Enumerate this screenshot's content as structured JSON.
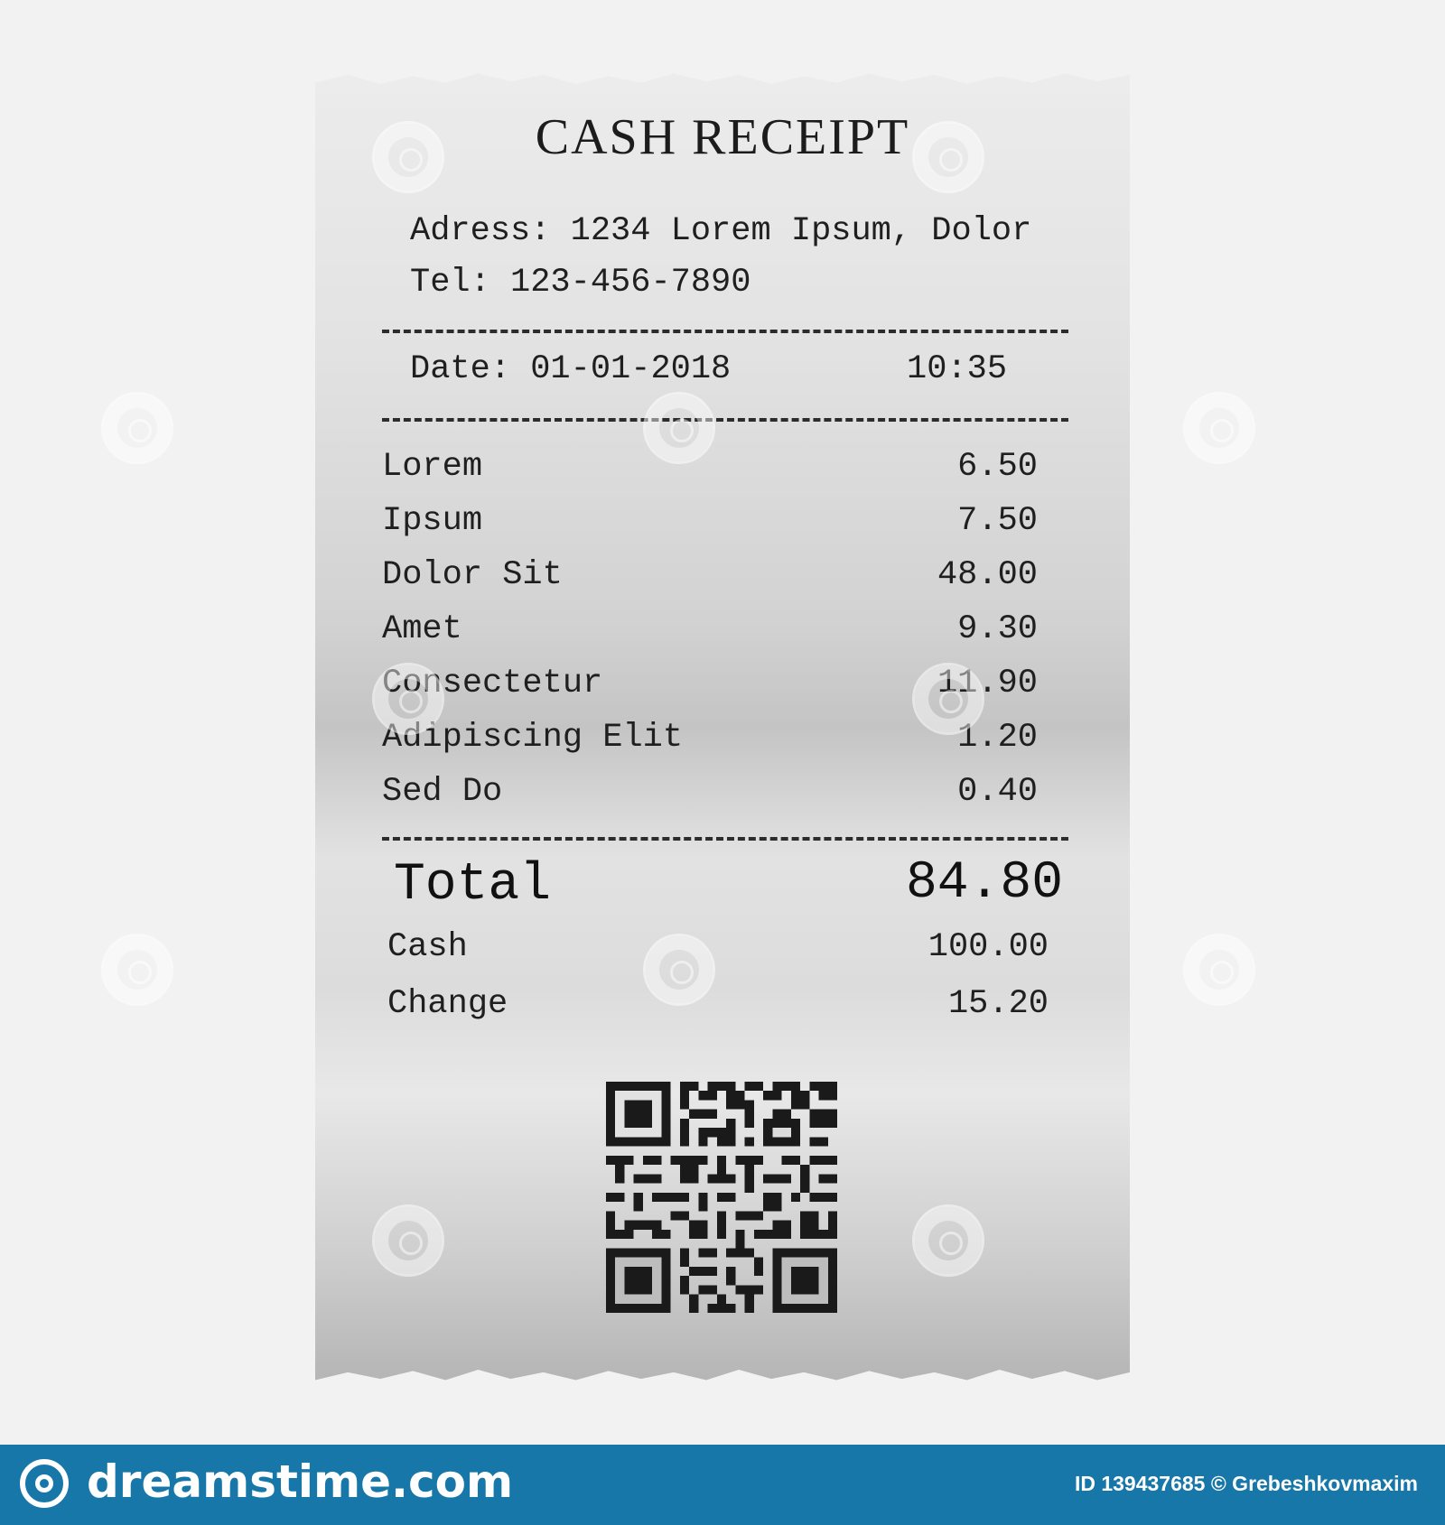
{
  "receipt": {
    "title": "CASH RECEIPT",
    "address": "Adress: 1234 Lorem Ipsum, Dolor",
    "tel": "Tel: 123-456-7890",
    "date": "Date: 01-01-2018",
    "time": "10:35",
    "items": [
      {
        "name": "Lorem",
        "price": "6.50"
      },
      {
        "name": "Ipsum",
        "price": "7.50"
      },
      {
        "name": "Dolor Sit",
        "price": "48.00"
      },
      {
        "name": "Amet",
        "price": "9.30"
      },
      {
        "name": "Consectetur",
        "price": "11.90"
      },
      {
        "name": "Adipiscing Elit",
        "price": "1.20"
      },
      {
        "name": "Sed Do",
        "price": "0.40"
      }
    ],
    "total_label": "Total",
    "total_value": "84.80",
    "cash_label": "Cash",
    "cash_value": "100.00",
    "change_label": "Change",
    "change_value": "15.20",
    "qr_icon": "qr-code-icon"
  },
  "footer": {
    "logo_text": "dreamstime.com",
    "credit": "ID 139437685 © Grebeshkovmaxim",
    "background": "#1677a8",
    "logo_icon": "dreamstime-spiral-icon"
  }
}
